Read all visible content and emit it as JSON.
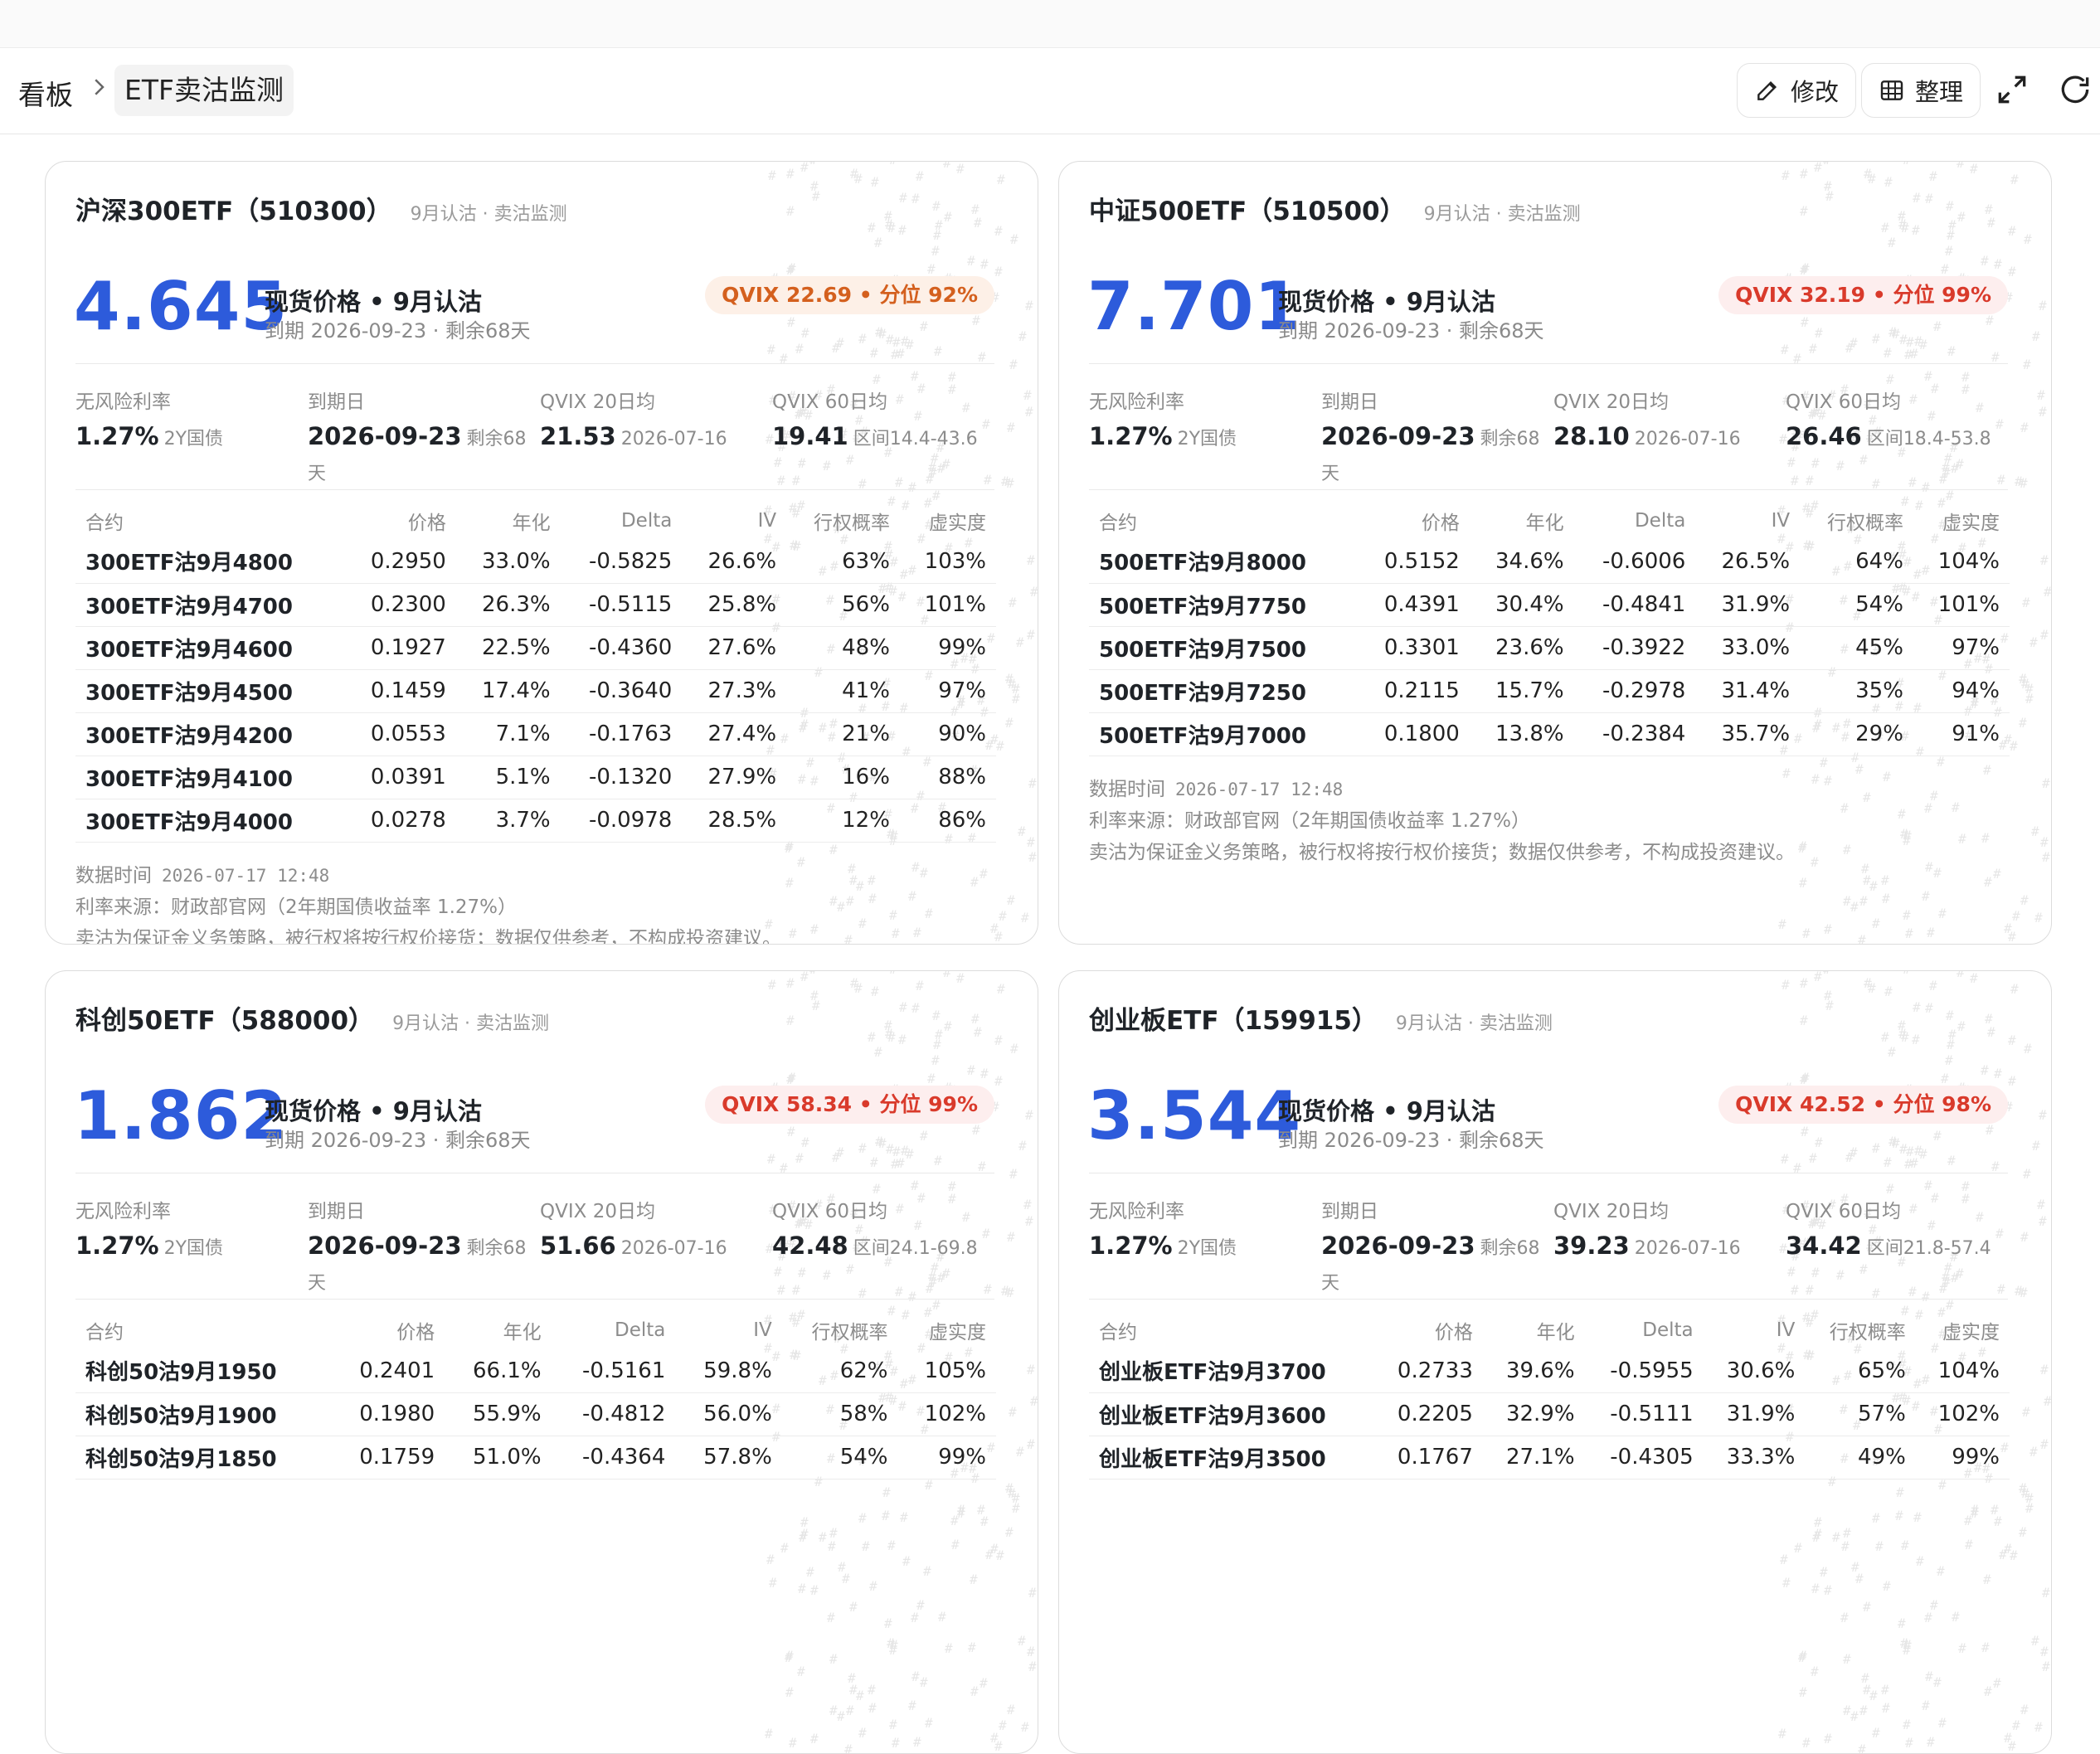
{
  "breadcrumb": {
    "root": "看板",
    "current": "ETF卖沽监测"
  },
  "toolbar": {
    "edit_label": "修改",
    "arrange_label": "整理"
  },
  "cards": [
    {
      "title": "沪深300ETF（510300）",
      "subtitle": "9月认沽 · 卖沽监测",
      "price": "4.645",
      "price_label": "现货价格 • 9月认沽",
      "expiry_text": "到期 2026-09-23 · 剩余68天",
      "qvix_badge": "QVIX 22.69 • 分位 92%",
      "qvix_tone": "orange",
      "stats": [
        {
          "label": "无风险利率",
          "value": "1.27%",
          "extra": "2Y国债"
        },
        {
          "label": "到期日",
          "value": "2026-09-23",
          "extra": "剩余68天"
        },
        {
          "label": "QVIX 20日均",
          "value": "21.53",
          "extra": "2026-07-16"
        },
        {
          "label": "QVIX 60日均",
          "value": "19.41",
          "extra": "区间14.4-43.6"
        }
      ],
      "headers": [
        "合约",
        "价格",
        "年化",
        "Delta",
        "IV",
        "行权概率",
        "虚实度"
      ],
      "rows": [
        [
          "300ETF沽9月4800",
          "0.2950",
          "33.0%",
          "-0.5825",
          "26.6%",
          "63%",
          "103%"
        ],
        [
          "300ETF沽9月4700",
          "0.2300",
          "26.3%",
          "-0.5115",
          "25.8%",
          "56%",
          "101%"
        ],
        [
          "300ETF沽9月4600",
          "0.1927",
          "22.5%",
          "-0.4360",
          "27.6%",
          "48%",
          "99%"
        ],
        [
          "300ETF沽9月4500",
          "0.1459",
          "17.4%",
          "-0.3640",
          "27.3%",
          "41%",
          "97%"
        ],
        [
          "300ETF沽9月4200",
          "0.0553",
          "7.1%",
          "-0.1763",
          "27.4%",
          "21%",
          "90%"
        ],
        [
          "300ETF沽9月4100",
          "0.0391",
          "5.1%",
          "-0.1320",
          "27.9%",
          "16%",
          "88%"
        ],
        [
          "300ETF沽9月4000",
          "0.0278",
          "3.7%",
          "-0.0978",
          "28.5%",
          "12%",
          "86%"
        ]
      ],
      "footer": {
        "time_label": "数据时间",
        "time_value": "2026-07-17 12:48",
        "rate_source": "利率来源：财政部官网（2年期国债收益率 1.27%）",
        "disclaimer": "卖沽为保证金义务策略，被行权将按行权价接货；数据仅供参考，不构成投资建议。"
      }
    },
    {
      "title": "中证500ETF（510500）",
      "subtitle": "9月认沽 · 卖沽监测",
      "price": "7.701",
      "price_label": "现货价格 • 9月认沽",
      "expiry_text": "到期 2026-09-23 · 剩余68天",
      "qvix_badge": "QVIX 32.19 • 分位 99%",
      "qvix_tone": "red",
      "stats": [
        {
          "label": "无风险利率",
          "value": "1.27%",
          "extra": "2Y国债"
        },
        {
          "label": "到期日",
          "value": "2026-09-23",
          "extra": "剩余68天"
        },
        {
          "label": "QVIX 20日均",
          "value": "28.10",
          "extra": "2026-07-16"
        },
        {
          "label": "QVIX 60日均",
          "value": "26.46",
          "extra": "区间18.4-53.8"
        }
      ],
      "headers": [
        "合约",
        "价格",
        "年化",
        "Delta",
        "IV",
        "行权概率",
        "虚实度"
      ],
      "rows": [
        [
          "500ETF沽9月8000",
          "0.5152",
          "34.6%",
          "-0.6006",
          "26.5%",
          "64%",
          "104%"
        ],
        [
          "500ETF沽9月7750",
          "0.4391",
          "30.4%",
          "-0.4841",
          "31.9%",
          "54%",
          "101%"
        ],
        [
          "500ETF沽9月7500",
          "0.3301",
          "23.6%",
          "-0.3922",
          "33.0%",
          "45%",
          "97%"
        ],
        [
          "500ETF沽9月7250",
          "0.2115",
          "15.7%",
          "-0.2978",
          "31.4%",
          "35%",
          "94%"
        ],
        [
          "500ETF沽9月7000",
          "0.1800",
          "13.8%",
          "-0.2384",
          "35.7%",
          "29%",
          "91%"
        ]
      ],
      "footer": {
        "time_label": "数据时间",
        "time_value": "2026-07-17 12:48",
        "rate_source": "利率来源：财政部官网（2年期国债收益率 1.27%）",
        "disclaimer": "卖沽为保证金义务策略，被行权将按行权价接货；数据仅供参考，不构成投资建议。"
      }
    },
    {
      "title": "科创50ETF（588000）",
      "subtitle": "9月认沽 · 卖沽监测",
      "price": "1.862",
      "price_label": "现货价格 • 9月认沽",
      "expiry_text": "到期 2026-09-23 · 剩余68天",
      "qvix_badge": "QVIX 58.34 • 分位 99%",
      "qvix_tone": "red",
      "stats": [
        {
          "label": "无风险利率",
          "value": "1.27%",
          "extra": "2Y国债"
        },
        {
          "label": "到期日",
          "value": "2026-09-23",
          "extra": "剩余68天"
        },
        {
          "label": "QVIX 20日均",
          "value": "51.66",
          "extra": "2026-07-16"
        },
        {
          "label": "QVIX 60日均",
          "value": "42.48",
          "extra": "区间24.1-69.8"
        }
      ],
      "headers": [
        "合约",
        "价格",
        "年化",
        "Delta",
        "IV",
        "行权概率",
        "虚实度"
      ],
      "rows": [
        [
          "科创50沽9月1950",
          "0.2401",
          "66.1%",
          "-0.5161",
          "59.8%",
          "62%",
          "105%"
        ],
        [
          "科创50沽9月1900",
          "0.1980",
          "55.9%",
          "-0.4812",
          "56.0%",
          "58%",
          "102%"
        ],
        [
          "科创50沽9月1850",
          "0.1759",
          "51.0%",
          "-0.4364",
          "57.8%",
          "54%",
          "99%"
        ]
      ],
      "footer": {
        "time_label": "",
        "time_value": "",
        "rate_source": "",
        "disclaimer": ""
      }
    },
    {
      "title": "创业板ETF（159915）",
      "subtitle": "9月认沽 · 卖沽监测",
      "price": "3.544",
      "price_label": "现货价格 • 9月认沽",
      "expiry_text": "到期 2026-09-23 · 剩余68天",
      "qvix_badge": "QVIX 42.52 • 分位 98%",
      "qvix_tone": "red",
      "stats": [
        {
          "label": "无风险利率",
          "value": "1.27%",
          "extra": "2Y国债"
        },
        {
          "label": "到期日",
          "value": "2026-09-23",
          "extra": "剩余68天"
        },
        {
          "label": "QVIX 20日均",
          "value": "39.23",
          "extra": "2026-07-16"
        },
        {
          "label": "QVIX 60日均",
          "value": "34.42",
          "extra": "区间21.8-57.4"
        }
      ],
      "headers": [
        "合约",
        "价格",
        "年化",
        "Delta",
        "IV",
        "行权概率",
        "虚实度"
      ],
      "rows": [
        [
          "创业板ETF沽9月3700",
          "0.2733",
          "39.6%",
          "-0.5955",
          "30.6%",
          "65%",
          "104%"
        ],
        [
          "创业板ETF沽9月3600",
          "0.2205",
          "32.9%",
          "-0.5111",
          "31.9%",
          "57%",
          "102%"
        ],
        [
          "创业板ETF沽9月3500",
          "0.1767",
          "27.1%",
          "-0.4305",
          "33.3%",
          "49%",
          "99%"
        ]
      ],
      "footer": {
        "time_label": "",
        "time_value": "",
        "rate_source": "",
        "disclaimer": ""
      }
    }
  ]
}
